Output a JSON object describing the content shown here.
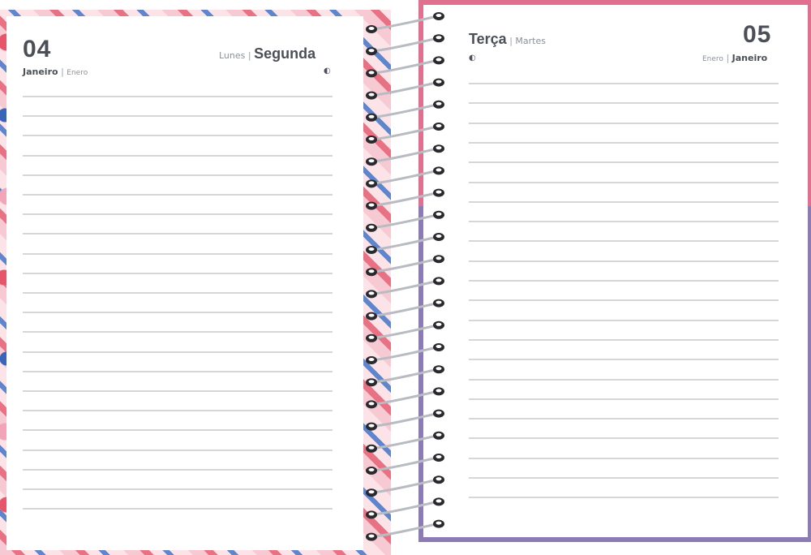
{
  "left_page": {
    "day_number": "04",
    "weekday_alt": "Lunes",
    "weekday_sep": "|",
    "weekday": "Segunda",
    "month": "Janeiro",
    "month_sep": "|",
    "month_alt": "Enero",
    "moon_icon": "◐"
  },
  "right_page": {
    "day_number": "05",
    "weekday": "Terça",
    "weekday_sep": "|",
    "weekday_alt": "Martes",
    "month_alt": "Enero",
    "month_sep": "|",
    "month": "Janeiro",
    "moon_icon": "◐"
  },
  "colors": {
    "right_cover_top": "#e16f90",
    "right_cover_bottom": "#8c7bb5",
    "floral_red": "#e5566a",
    "floral_blue": "#3a64b5",
    "text": "#4a4f58"
  }
}
